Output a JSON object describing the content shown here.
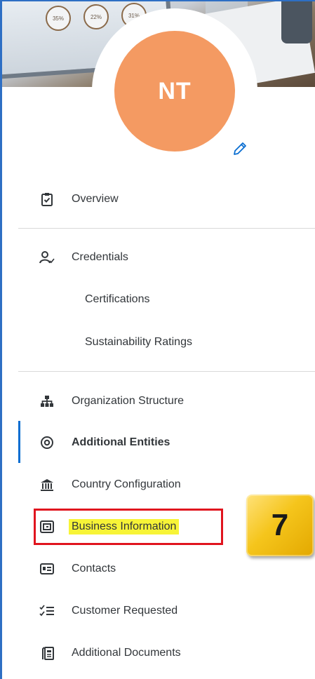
{
  "header": {
    "banner_gauges": [
      "35%",
      "22%",
      "31%"
    ],
    "avatar_initials": "NT",
    "avatar_color": "#f49a62"
  },
  "nav": {
    "overview": "Overview",
    "credentials": "Credentials",
    "credentials_sub": [
      "Certifications",
      "Sustainability Ratings"
    ],
    "organization_structure": "Organization Structure",
    "additional_entities": "Additional Entities",
    "country_configuration": "Country Configuration",
    "business_information": "Business Information",
    "contacts": "Contacts",
    "customer_requested": "Customer Requested",
    "additional_documents": "Additional Documents"
  },
  "annotation": {
    "step_number": "7",
    "highlight_color": "#f7f437",
    "box_color": "#e0141e"
  },
  "icons": {
    "overview": "clipboard-check-icon",
    "credentials": "person-check-icon",
    "organization_structure": "org-chart-icon",
    "additional_entities": "location-icon",
    "country_configuration": "bank-icon",
    "business_information": "business-card-icon",
    "contacts": "contact-card-icon",
    "customer_requested": "checklist-icon",
    "additional_documents": "documents-icon",
    "edit": "pencil-icon"
  }
}
